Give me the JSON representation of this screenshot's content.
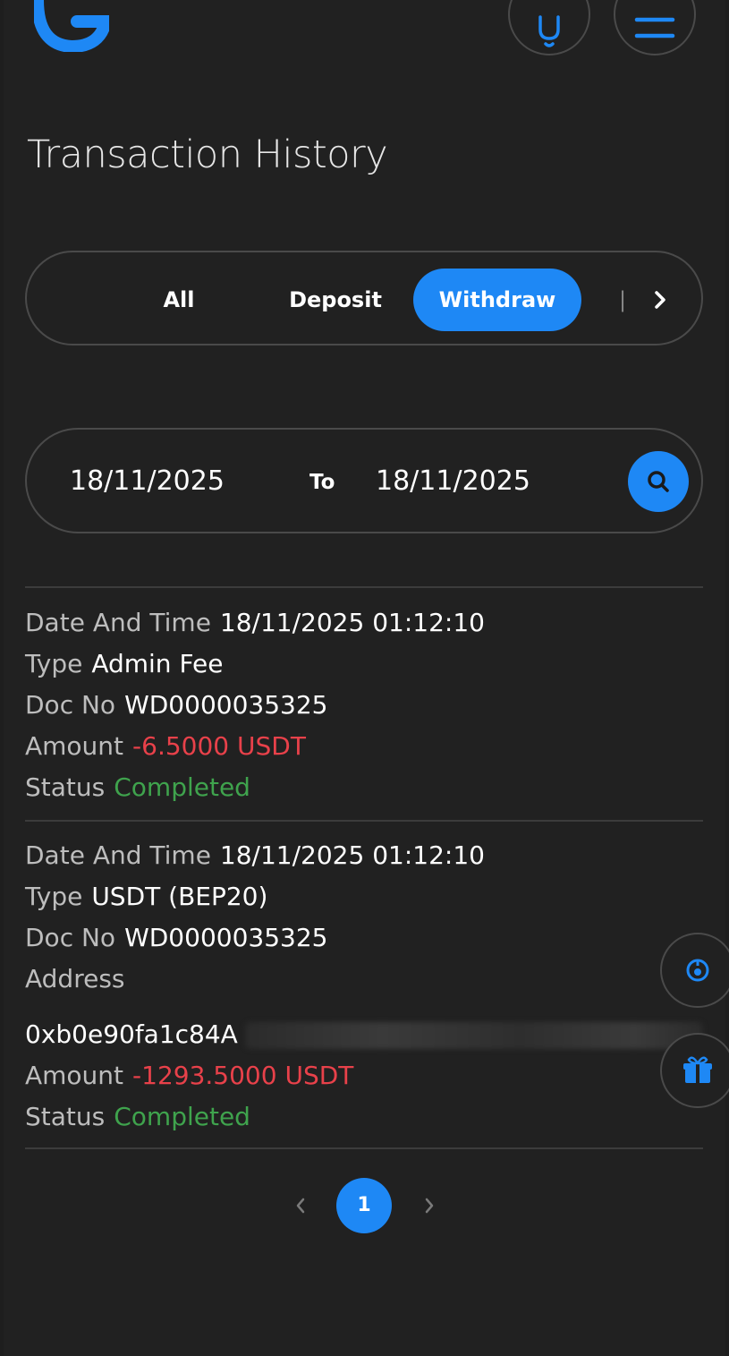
{
  "header": {
    "logo_icon": "g-logo-icon",
    "bell_icon": "bell-icon",
    "menu_icon": "hamburger-menu-icon"
  },
  "page_title": "Transaction History",
  "tabs": [
    {
      "label": "All",
      "active": false
    },
    {
      "label": "Deposit",
      "active": false
    },
    {
      "label": "Withdraw",
      "active": true
    }
  ],
  "filter": {
    "date_from": "18/11/2025",
    "separator": "To",
    "date_to": "18/11/2025"
  },
  "labels": {
    "date_time": "Date And Time",
    "type": "Type",
    "doc_no": "Doc No",
    "address": "Address",
    "amount": "Amount",
    "status": "Status"
  },
  "transactions": [
    {
      "date_time": "18/11/2025 01:12:10",
      "type": "Admin Fee",
      "doc_no": "WD0000035325",
      "amount": "-6.5000 USDT",
      "status": "Completed"
    },
    {
      "date_time": "18/11/2025 01:12:10",
      "type": "USDT (BEP20)",
      "doc_no": "WD0000035325",
      "address": "0xb0e90fa1c84A",
      "amount": "-1293.5000 USDT",
      "status": "Completed"
    }
  ],
  "pagination": {
    "current_page": "1"
  },
  "colors": {
    "accent": "#1e88f5",
    "negative": "#e8414a",
    "positive": "#3fa34d",
    "background": "#212121"
  }
}
